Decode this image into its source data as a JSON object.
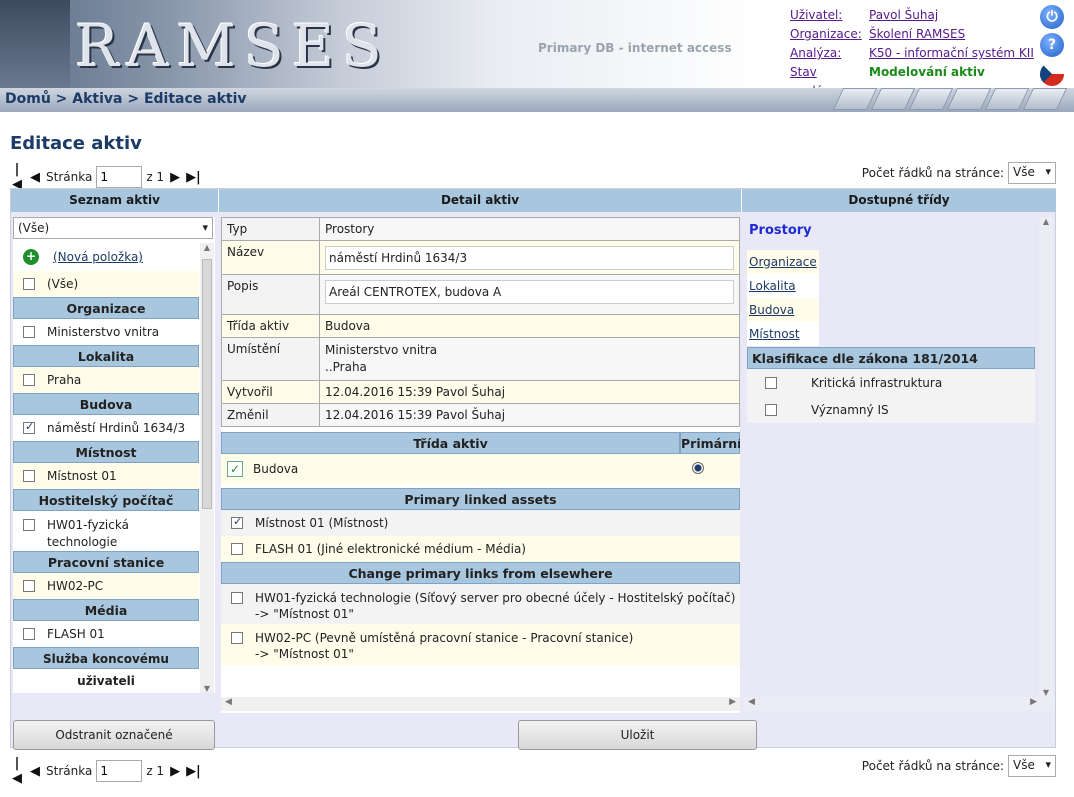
{
  "header": {
    "logo_text": "RAMSES",
    "db_info": "Primary DB - internet access",
    "meta": [
      {
        "label": "Uživatel:",
        "value": "Pavol Šuhaj"
      },
      {
        "label": "Organizace:",
        "value": "Školení RAMSES"
      },
      {
        "label": "Analýza:",
        "value": "K50 - informační systém KII"
      },
      {
        "label": "Stav analýzy:",
        "value": "Modelování aktiv"
      }
    ],
    "power_icon": "power-icon",
    "help_icon": "help-icon",
    "flag_icon": "czech-flag-icon"
  },
  "breadcrumb": "Domů > Aktiva > Editace aktiv",
  "page_title": "Editace aktiv",
  "pager": {
    "first": "|◀",
    "prev": "◀",
    "page_label": "Stránka",
    "page_value": "1",
    "of_label": "z 1",
    "next": "▶",
    "last": "▶|",
    "rows_label": "Počet řádků na stránce:",
    "rows_value": "Vše"
  },
  "columns": {
    "list": "Seznam aktiv",
    "detail": "Detail aktiv",
    "classes": "Dostupné třídy"
  },
  "list": {
    "filter_value": "(Vše)",
    "new_item": "(Nová položka)",
    "all_item": "(Vše)",
    "groups": [
      {
        "title": "Organizace",
        "items": [
          {
            "label": "Ministerstvo vnitra",
            "checked": false
          }
        ]
      },
      {
        "title": "Lokalita",
        "items": [
          {
            "label": "Praha",
            "checked": false
          }
        ]
      },
      {
        "title": "Budova",
        "items": [
          {
            "label": "náměstí Hrdinů 1634/3",
            "checked": true
          }
        ]
      },
      {
        "title": "Místnost",
        "items": [
          {
            "label": "Místnost 01",
            "checked": false
          }
        ]
      },
      {
        "title": "Hostitelský počítač",
        "items": [
          {
            "label": "HW01-fyzická technologie",
            "checked": false
          }
        ]
      },
      {
        "title": "Pracovní stanice",
        "items": [
          {
            "label": "HW02-PC",
            "checked": false
          }
        ]
      },
      {
        "title": "Média",
        "items": [
          {
            "label": "FLASH 01",
            "checked": false
          }
        ]
      },
      {
        "title": "Služba koncovému uživateli",
        "items": []
      }
    ]
  },
  "detail": {
    "rows": [
      {
        "key": "Typ",
        "value": "Prostory"
      },
      {
        "key": "Název",
        "value": "náměstí Hrdinů 1634/3"
      },
      {
        "key": "Popis",
        "value": "Areál CENTROTEX, budova A"
      },
      {
        "key": "Třída aktiv",
        "value": "Budova"
      },
      {
        "key": "Umístění",
        "value": "Ministerstvo vnitra",
        "value2": "..Praha"
      },
      {
        "key": "Vytvořil",
        "value": "12.04.2016 15:39 Pavol Šuhaj"
      },
      {
        "key": "Změnil",
        "value": "12.04.2016 15:39 Pavol Šuhaj"
      }
    ],
    "class_header": "Třída aktiv",
    "primary_header": "Primární",
    "class_row": "Budova",
    "linked_header": "Primary linked assets",
    "linked": [
      {
        "label": "Místnost 01 (Místnost)",
        "checked": true
      },
      {
        "label": "FLASH 01 (Jiné elektronické médium - Média)",
        "checked": false
      }
    ],
    "change_header": "Change primary links from elsewhere",
    "change": [
      {
        "line1": "HW01-fyzická technologie (Síťový server pro obecné účely - Hostitelský počítač)",
        "line2": "-> \"Místnost 01\""
      },
      {
        "line1": "HW02-PC (Pevně umístěná pracovní stanice - Pracovní stanice)",
        "line2": "-> \"Místnost 01\""
      }
    ]
  },
  "classes": {
    "title": "Prostory",
    "links": [
      "Organizace",
      "Lokalita",
      "Budova",
      "Místnost"
    ],
    "law_header": "Klasifikace dle zákona 181/2014",
    "law_items": [
      "Kritická infrastruktura",
      "Významný IS"
    ]
  },
  "buttons": {
    "remove": "Odstranit označené",
    "save": "Uložit"
  }
}
